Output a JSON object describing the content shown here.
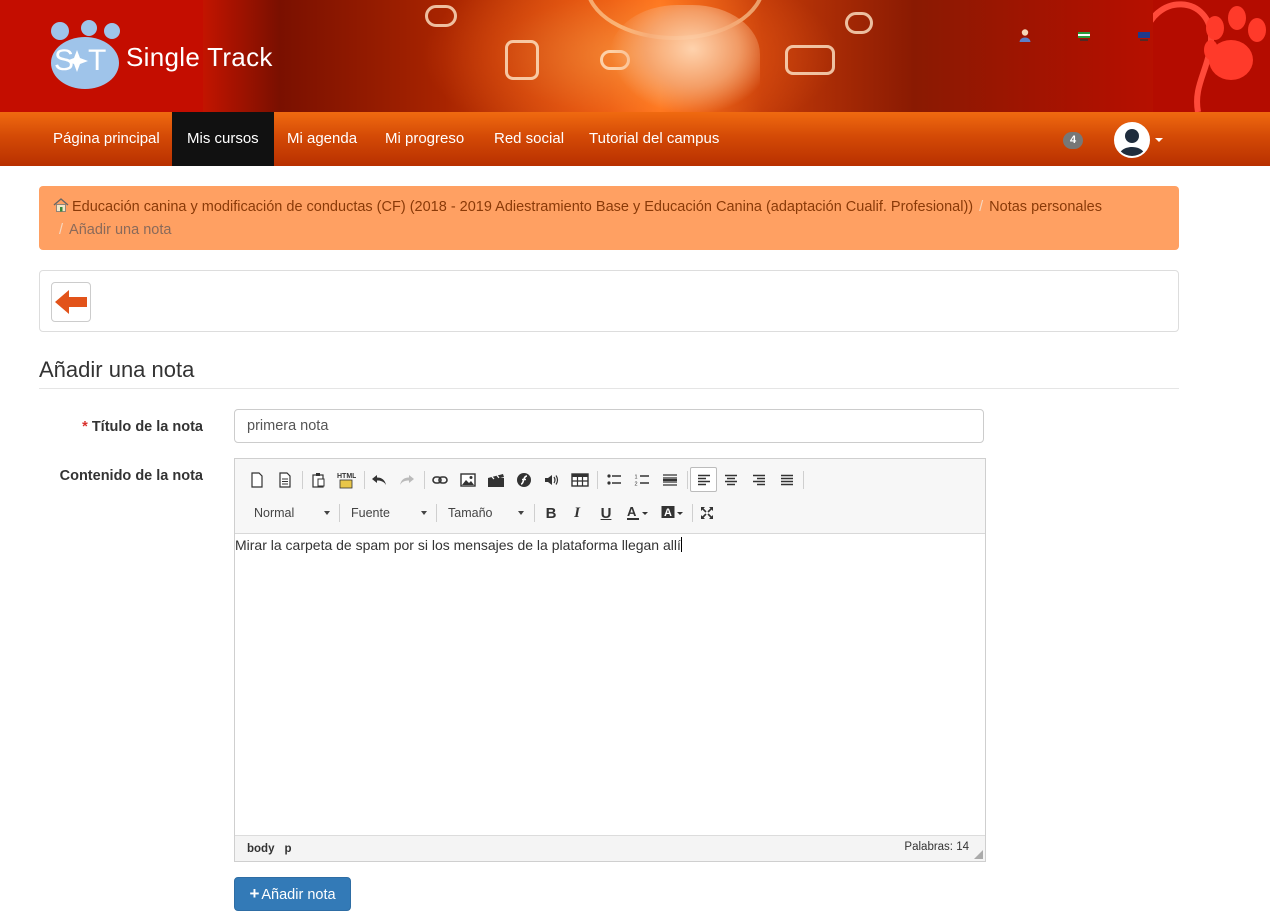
{
  "header": {
    "logo_text": "Single Track",
    "logo_initials": "S T"
  },
  "nav": {
    "items": [
      {
        "label": "Página principal",
        "active": false
      },
      {
        "label": "Mis cursos",
        "active": true
      },
      {
        "label": "Mi agenda",
        "active": false
      },
      {
        "label": "Mi progreso",
        "active": false
      },
      {
        "label": "Red social",
        "active": false
      },
      {
        "label": "Tutorial del campus",
        "active": false
      }
    ],
    "notifications_count": "4"
  },
  "breadcrumb": {
    "course": "Educación canina y modificación de conductas (CF) (2018 - 2019 Adiestramiento Base y Educación Canina (adaptación Cualif. Profesional))",
    "section": "Notas personales",
    "current": "Añadir una nota",
    "separator": "/"
  },
  "page": {
    "title": "Añadir una nota"
  },
  "form": {
    "title_label": "Título de la nota",
    "title_required_mark": "*",
    "title_value": "primera nota",
    "content_label": "Contenido de la nota",
    "content_text": "Mirar la carpeta de spam por si los mensajes de la plataforma llegan allí",
    "submit_label": "Añadir nota",
    "submit_icon": "+"
  },
  "editor": {
    "format_combo": "Normal",
    "font_combo": "Fuente",
    "size_combo": "Tamaño",
    "path": [
      "body",
      "p"
    ],
    "word_count": "Palabras: 14",
    "html_icon_text": "HTML"
  },
  "colors": {
    "navbar": "#d44a06",
    "breadcrumb_bg": "#ffa062",
    "primary_button": "#337ab7",
    "back_arrow": "#e2531a"
  }
}
